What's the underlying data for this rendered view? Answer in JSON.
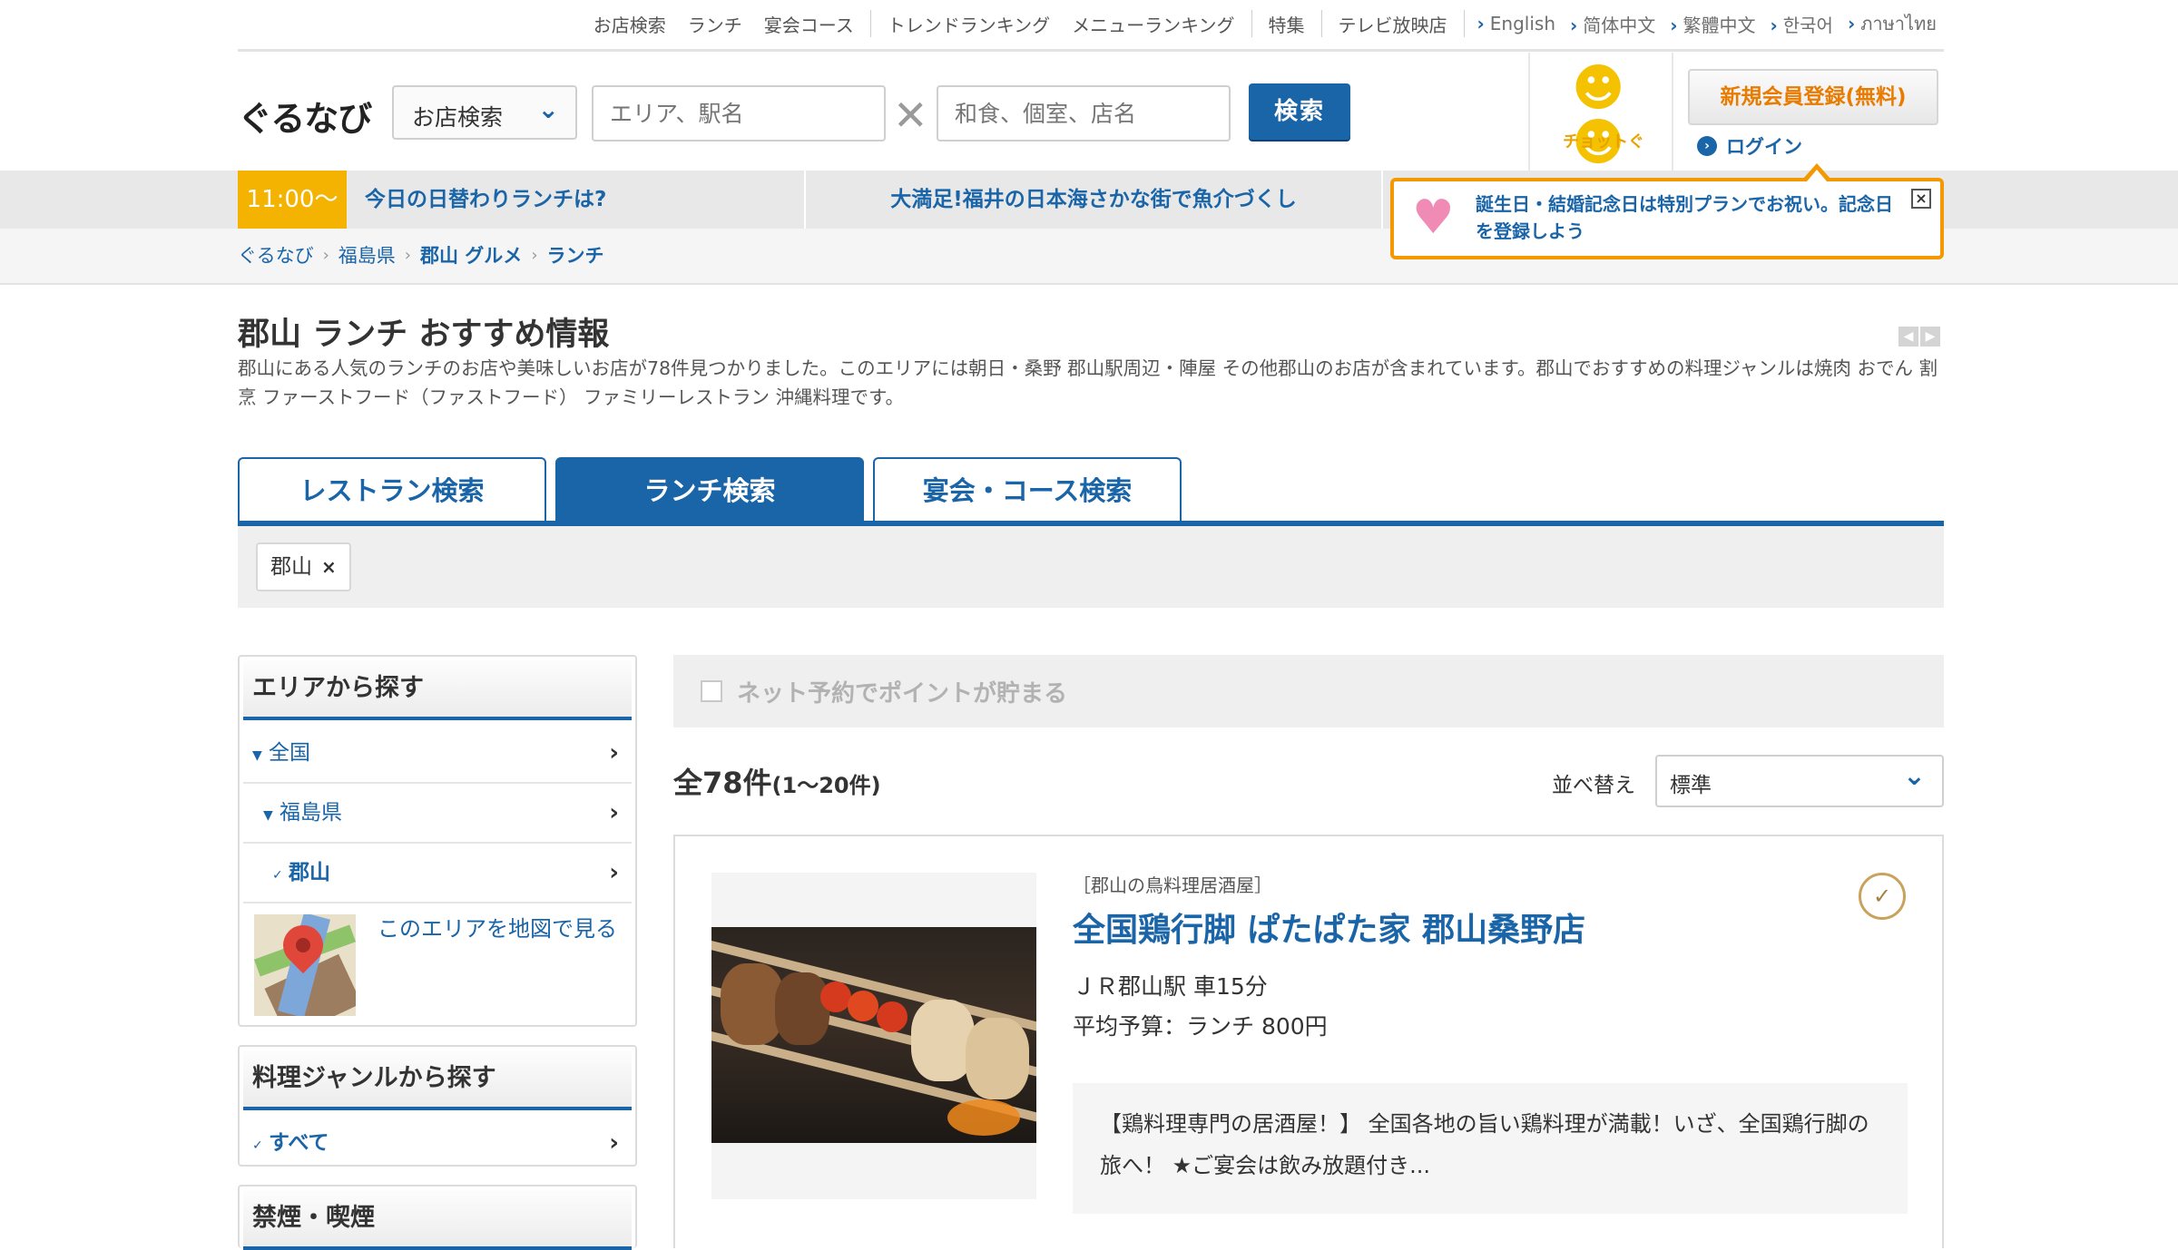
{
  "topnav": {
    "links": [
      "お店検索",
      "ランチ",
      "宴会コース",
      "トレンドランキング",
      "メニューランキング",
      "特集",
      "テレビ放映店"
    ],
    "languages": [
      "English",
      "简体中文",
      "繁體中文",
      "한국어",
      "ภาษาไทย"
    ]
  },
  "header": {
    "logo": "ぐるなび",
    "search_type": "お店検索",
    "area_placeholder": "エリア、駅名",
    "keyword_placeholder": "和食、個室、店名",
    "search_button": "検索",
    "chotto_label": "チョットぐ",
    "signup_button": "新規会員登録(無料)",
    "login": "ログイン"
  },
  "infobar": {
    "time": "11:00〜",
    "item1": "今日の日替わりランチは?",
    "item2": "大満足!福井の日本海さかな街で魚介づくし"
  },
  "tooltip": {
    "text": "誕生日・結婚記念日は特別プランでお祝い。記念日を登録しよう",
    "close": "×"
  },
  "breadcrumb": [
    "ぐるなび",
    "福島県",
    "郡山 グルメ",
    "ランチ"
  ],
  "page": {
    "title": "郡山 ランチ おすすめ情報",
    "description": "郡山にある人気のランチのお店や美味しいお店が78件見つかりました。このエリアには朝日・桑野 郡山駅周辺・陣屋 その他郡山のお店が含まれています。郡山でおすすめの料理ジャンルは焼肉 おでん 割烹 ファーストフード（ファストフード） ファミリーレストラン 沖縄料理です。"
  },
  "tabs": [
    {
      "label": "レストラン検索",
      "active": false
    },
    {
      "label": "ランチ検索",
      "active": true
    },
    {
      "label": "宴会・コース検索",
      "active": false
    }
  ],
  "filter": {
    "chip": "郡山",
    "chip_remove": "×"
  },
  "sidebar": {
    "area": {
      "heading": "エリアから探す",
      "items": [
        "全国",
        "福島県",
        "郡山"
      ],
      "map_link": "このエリアを地図で見る"
    },
    "genre": {
      "heading": "料理ジャンルから探す",
      "items": [
        "すべて"
      ]
    },
    "smoking": {
      "heading": "禁煙・喫煙"
    }
  },
  "results": {
    "point_checkbox": "ネット予約でポイントが貯まる",
    "count_main": "全78件",
    "count_range": "(1〜20件)",
    "sort_label": "並べ替え",
    "sort_value": "標準"
  },
  "restaurant": {
    "genre": "［郡山の鳥料理居酒屋］",
    "name": "全国鶏行脚 ぱたぱた家 郡山桑野店",
    "access": "ＪＲ郡山駅 車15分",
    "budget": "平均予算：ランチ 800円",
    "pr_text": "【鶏料理専門の居酒屋！】 全国各地の旨い鶏料理が満載！いざ、全国鶏行脚の旅へ！ ★ご宴会は飲み放題付き..."
  },
  "colors": {
    "brand_blue": "#1a64a8",
    "accent_orange": "#f39800",
    "time_yellow": "#f3b300"
  }
}
